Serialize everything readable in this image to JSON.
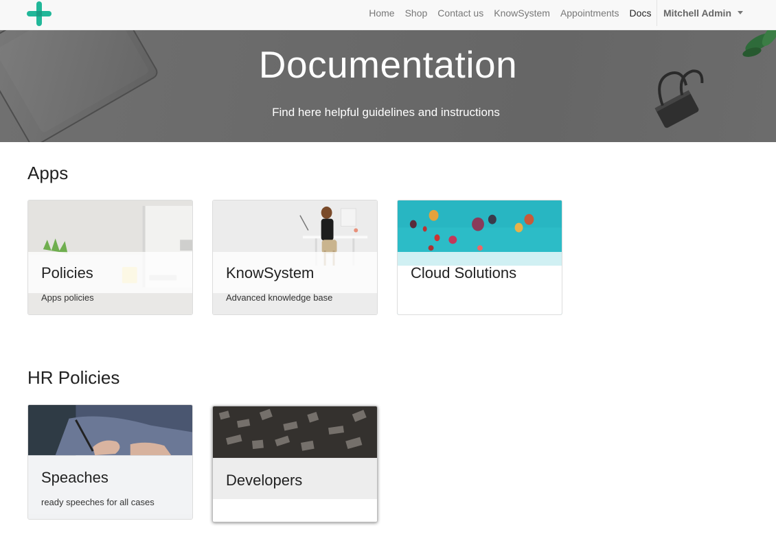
{
  "navbar": {
    "logo_icon": "plus-logo-icon",
    "accent_color": "#21b799",
    "links": [
      {
        "label": "Home",
        "active": false
      },
      {
        "label": "Shop",
        "active": false
      },
      {
        "label": "Contact us",
        "active": false
      },
      {
        "label": "KnowSystem",
        "active": false
      },
      {
        "label": "Appointments",
        "active": false
      },
      {
        "label": "Docs",
        "active": true
      }
    ],
    "user_name": "Mitchell Admin",
    "user_menu_icon": "caret-down-icon"
  },
  "hero": {
    "title": "Documentation",
    "subtitle": "Find here helpful guidelines and instructions"
  },
  "sections": [
    {
      "title": "Apps",
      "cards": [
        {
          "title": "Policies",
          "description": "Apps policies",
          "image": "desk-with-monitor-and-plant"
        },
        {
          "title": "KnowSystem",
          "description": "Advanced knowledge base",
          "image": "woman-working-at-white-desk"
        },
        {
          "title": "Cloud Solutions",
          "description": "",
          "image": "hot-air-balloons-in-blue-sky"
        }
      ]
    },
    {
      "title": "HR Policies",
      "cards": [
        {
          "title": "Speaches",
          "description": "ready speeches for all cases",
          "image": "hand-writing-with-pen"
        },
        {
          "title": "Developers",
          "description": "",
          "image": "printing-press-letter-blocks"
        }
      ]
    }
  ]
}
